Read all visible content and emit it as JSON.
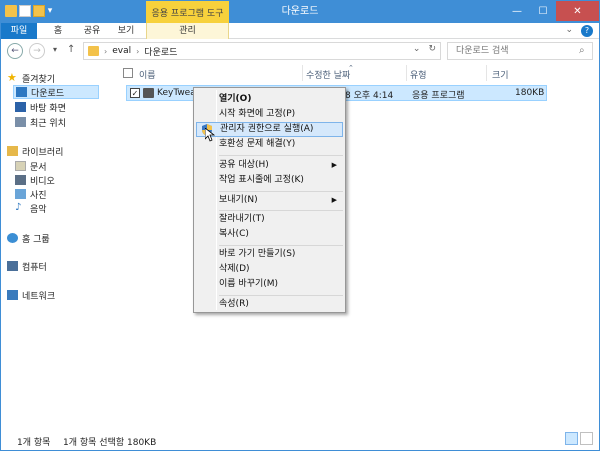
{
  "window": {
    "title": "다운로드",
    "context_tab_title": "응용 프로그램 도구",
    "minimize": "—",
    "maximize": "☐",
    "close": "✕"
  },
  "ribbon": {
    "tabs": [
      "파일",
      "홈",
      "공유",
      "보기",
      "관리"
    ],
    "expand": "⌄",
    "help": "?"
  },
  "address": {
    "back": "←",
    "forward": "→",
    "recent": "▾",
    "up": "↑",
    "path": [
      "eval",
      "다운로드"
    ],
    "dropdown": "⌄",
    "refresh": "↻",
    "search_placeholder": "다운로드 검색"
  },
  "nav": {
    "favorites": "즐겨찾기",
    "downloads": "다운로드",
    "desktop": "바탕 화면",
    "recent": "최근 위치",
    "libraries": "라이브러리",
    "documents": "문서",
    "videos": "비디오",
    "pictures": "사진",
    "music": "음악",
    "homegroup": "홈 그룹",
    "computer": "컴퓨터",
    "network": "네트워크"
  },
  "columns": {
    "name": "이름",
    "modified": "수정한 날짜",
    "type": "유형",
    "size": "크기"
  },
  "file": {
    "name": "KeyTweak",
    "modified_visible": "8 오후 4:14",
    "type": "응용 프로그램",
    "size": "180KB"
  },
  "context_menu": {
    "open": "열기(O)",
    "pin_start": "시작 화면에 고정(P)",
    "run_as_admin": "관리자 권한으로 실행(A)",
    "troubleshoot": "호환성 문제 해결(Y)",
    "share_with": "공유 대상(H)",
    "pin_taskbar": "작업 표시줄에 고정(K)",
    "send_to": "보내기(N)",
    "cut": "잘라내기(T)",
    "copy": "복사(C)",
    "create_shortcut": "바로 가기 만들기(S)",
    "delete": "삭제(D)",
    "rename": "이름 바꾸기(M)",
    "properties": "속성(R)",
    "submenu_arrow": "▶"
  },
  "status": {
    "item_count": "1개 항목",
    "selected": "1개 항목 선택함 180KB"
  },
  "colors": {
    "accent": "#3f8ed6",
    "file_tab": "#1979ca",
    "context_tab": "#f7d13c",
    "selection": "#cce8ff"
  }
}
